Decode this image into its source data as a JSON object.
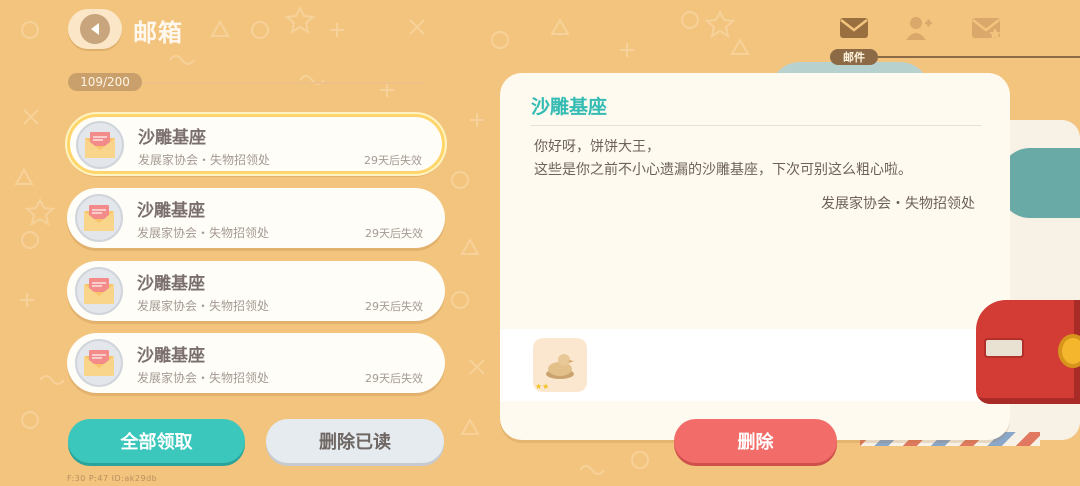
{
  "header": {
    "title": "邮箱",
    "counter": "109/200"
  },
  "tabs": [
    {
      "label": "邮件",
      "icon": "mail-icon",
      "active": true
    },
    {
      "icon": "add-friend-icon",
      "active": false
    },
    {
      "icon": "starred-mail-icon",
      "active": false
    }
  ],
  "mail_list": [
    {
      "title": "沙雕基座",
      "sender": "发展家协会・失物招领处",
      "expires": "29天后失效",
      "selected": true
    },
    {
      "title": "沙雕基座",
      "sender": "发展家协会・失物招领处",
      "expires": "29天后失效",
      "selected": false
    },
    {
      "title": "沙雕基座",
      "sender": "发展家协会・失物招领处",
      "expires": "29天后失效",
      "selected": false
    },
    {
      "title": "沙雕基座",
      "sender": "发展家协会・失物招领处",
      "expires": "29天后失效",
      "selected": false
    }
  ],
  "buttons": {
    "collect_all": "全部领取",
    "delete_read": "删除已读",
    "delete": "删除"
  },
  "detail": {
    "title": "沙雕基座",
    "greeting": "你好呀，饼饼大王，",
    "message": "这些是你之前不小心遗漏的沙雕基座，下次可别这么粗心啦。",
    "signature": "发展家协会・失物招领处",
    "attachment": {
      "icon": "sand-sculpture-base-icon",
      "stars": "★★"
    }
  },
  "debug": "F:30  P:47  ID:ak29db",
  "colors": {
    "background": "#f3c47e",
    "accent_teal": "#3cc7bd",
    "delete_red": "#f26d69",
    "selected_border": "#ffd66b"
  }
}
